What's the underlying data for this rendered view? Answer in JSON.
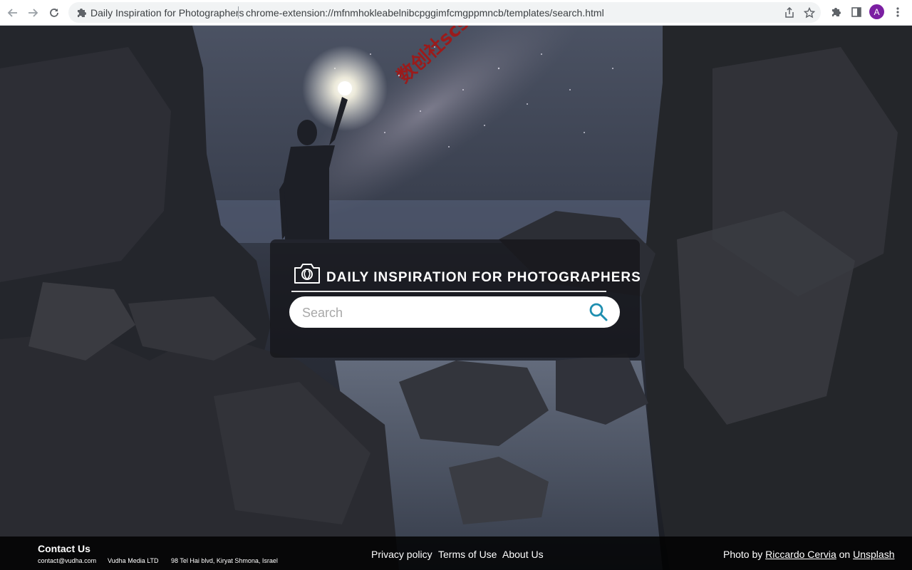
{
  "browser": {
    "tab_title": "Daily Inspiration for Photographers",
    "url": "chrome-extension://mfnmhokleabelnibcpggimfcmgppmncb/templates/search.html",
    "avatar_letter": "A",
    "avatar_color": "#7b1fa2"
  },
  "watermark": {
    "text": "数创社scs66",
    "color": "#9b1b1b"
  },
  "panel": {
    "brand_text": "DAILY INSPIRATION FOR PHOTOGRAPHERS",
    "search_placeholder": "Search",
    "search_value": "",
    "accent_color": "#1e8fb0"
  },
  "footer": {
    "contact_title": "Contact Us",
    "email": "contact@vudha.com",
    "company": "Vudha Media LTD",
    "address": "98 Tel Hai blvd, Kiryat Shmona, Israel",
    "links": [
      "Privacy policy",
      "Terms of Use",
      "About Us"
    ],
    "credit_prefix": "Photo by",
    "photographer": "Riccardo Cervia",
    "credit_middle": "on",
    "source": "Unsplash"
  }
}
